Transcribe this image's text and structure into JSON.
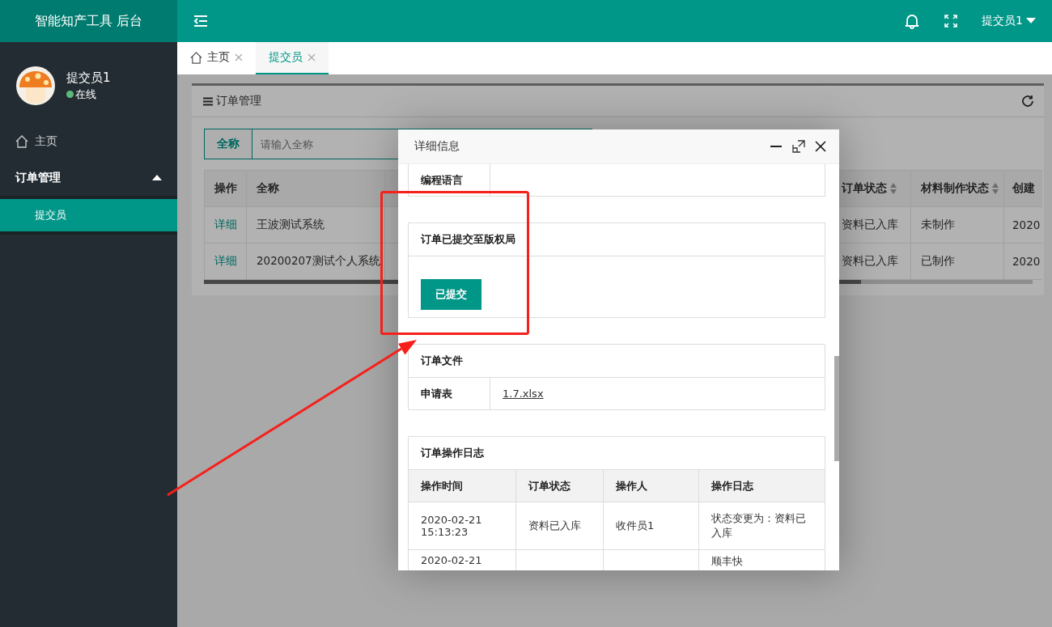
{
  "app": {
    "title": "智能知产工具 后台",
    "user": "提交员1"
  },
  "profile": {
    "name": "提交员1",
    "status": "在线",
    "online": true
  },
  "sidebar": {
    "items": [
      {
        "label": "主页",
        "kind": "link",
        "selected": false
      },
      {
        "label": "订单管理",
        "kind": "group",
        "expanded": true,
        "children": [
          {
            "label": "提交员",
            "selected": true
          }
        ]
      }
    ]
  },
  "tabs": [
    {
      "label": "主页",
      "kind": "home",
      "selected": false
    },
    {
      "label": "提交员",
      "kind": "plain",
      "selected": true
    }
  ],
  "panel": {
    "title": "订单管理",
    "search": {
      "label": "全称",
      "placeholder": "请输入全称"
    },
    "table": {
      "columns": [
        {
          "label": "操作",
          "sortable": false
        },
        {
          "label": "全称",
          "sortable": false
        },
        {
          "label": "订单状态",
          "sortable": true
        },
        {
          "label": "材料制作状态",
          "sortable": true
        },
        {
          "label": "创建",
          "sortable": false
        }
      ],
      "rows": [
        {
          "cells": [
            "详细",
            "王波测试系统",
            "资料已入库",
            "未制作",
            "2020"
          ]
        },
        {
          "cells": [
            "详细",
            "20200207测试个人系统",
            "资料已入库",
            "已制作",
            "2020"
          ]
        }
      ]
    }
  },
  "dialog": {
    "title": "详细信息",
    "info_rows": [
      {
        "label": "编程语言"
      }
    ],
    "submit_section": {
      "title": "订单已提交至版权局",
      "button": "已提交"
    },
    "files_section": {
      "title": "订单文件",
      "rows": [
        {
          "label": "申请表",
          "link": "1.7.xlsx"
        }
      ]
    },
    "log_section": {
      "title": "订单操作日志",
      "columns": [
        "操作时间",
        "订单状态",
        "操作人",
        "操作日志"
      ],
      "rows": [
        {
          "cells": [
            "2020-02-21 15:13:23",
            "资料已入库",
            "收件员1",
            "状态变更为：资料已入库"
          ]
        },
        {
          "cells": [
            "2020-02-21",
            "",
            "",
            "顺丰快"
          ]
        }
      ]
    }
  }
}
